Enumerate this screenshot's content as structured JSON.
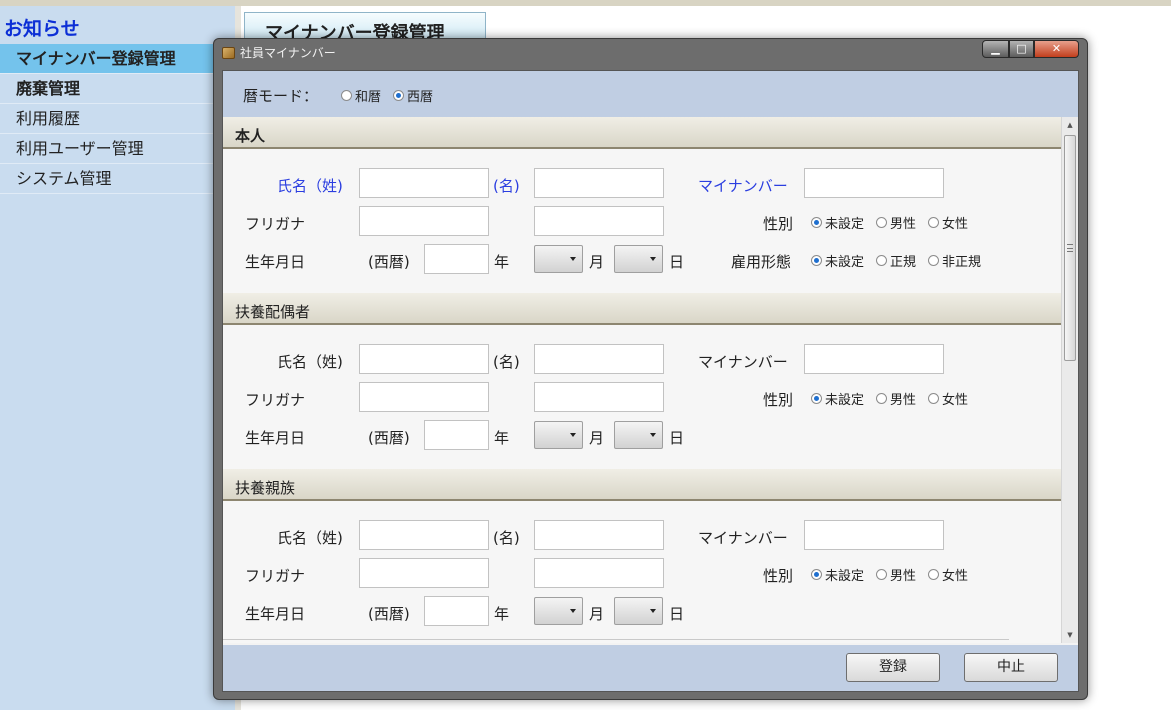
{
  "sidebar": {
    "notice": "お知らせ",
    "items": [
      {
        "label": "マイナンバー登録管理"
      },
      {
        "label": "廃棄管理"
      },
      {
        "label": "利用履歴"
      },
      {
        "label": "利用ユーザー管理"
      },
      {
        "label": "システム管理"
      }
    ]
  },
  "page_tab": "マイナンバー登録管理",
  "dialog": {
    "title": "社員マイナンバー",
    "mode": {
      "label": "暦モード：",
      "options": [
        {
          "label": "和暦",
          "selected": false
        },
        {
          "label": "西暦",
          "selected": true
        }
      ]
    },
    "common": {
      "name_sei": "氏名（姓)",
      "name_mei": "(名)",
      "mynumber": "マイナンバー",
      "furigana": "フリガナ",
      "birthdate": "生年月日",
      "era": "(西暦)",
      "year": "年",
      "month": "月",
      "day": "日",
      "gender": "性別",
      "employment": "雇用形態"
    },
    "gender_options": [
      "未設定",
      "男性",
      "女性"
    ],
    "employment_options": [
      "未設定",
      "正規",
      "非正規"
    ],
    "sections": [
      {
        "title": "本人"
      },
      {
        "title": "扶養配偶者"
      },
      {
        "title": "扶養親族"
      }
    ],
    "buttons": {
      "register": "登録",
      "cancel": "中止"
    }
  },
  "colors": {
    "required_label": "#2b3ee0",
    "radio_selected": "#1f6fcf",
    "sidebar_active": "#74c3ec",
    "dialog_bar": "#c0cee3"
  }
}
